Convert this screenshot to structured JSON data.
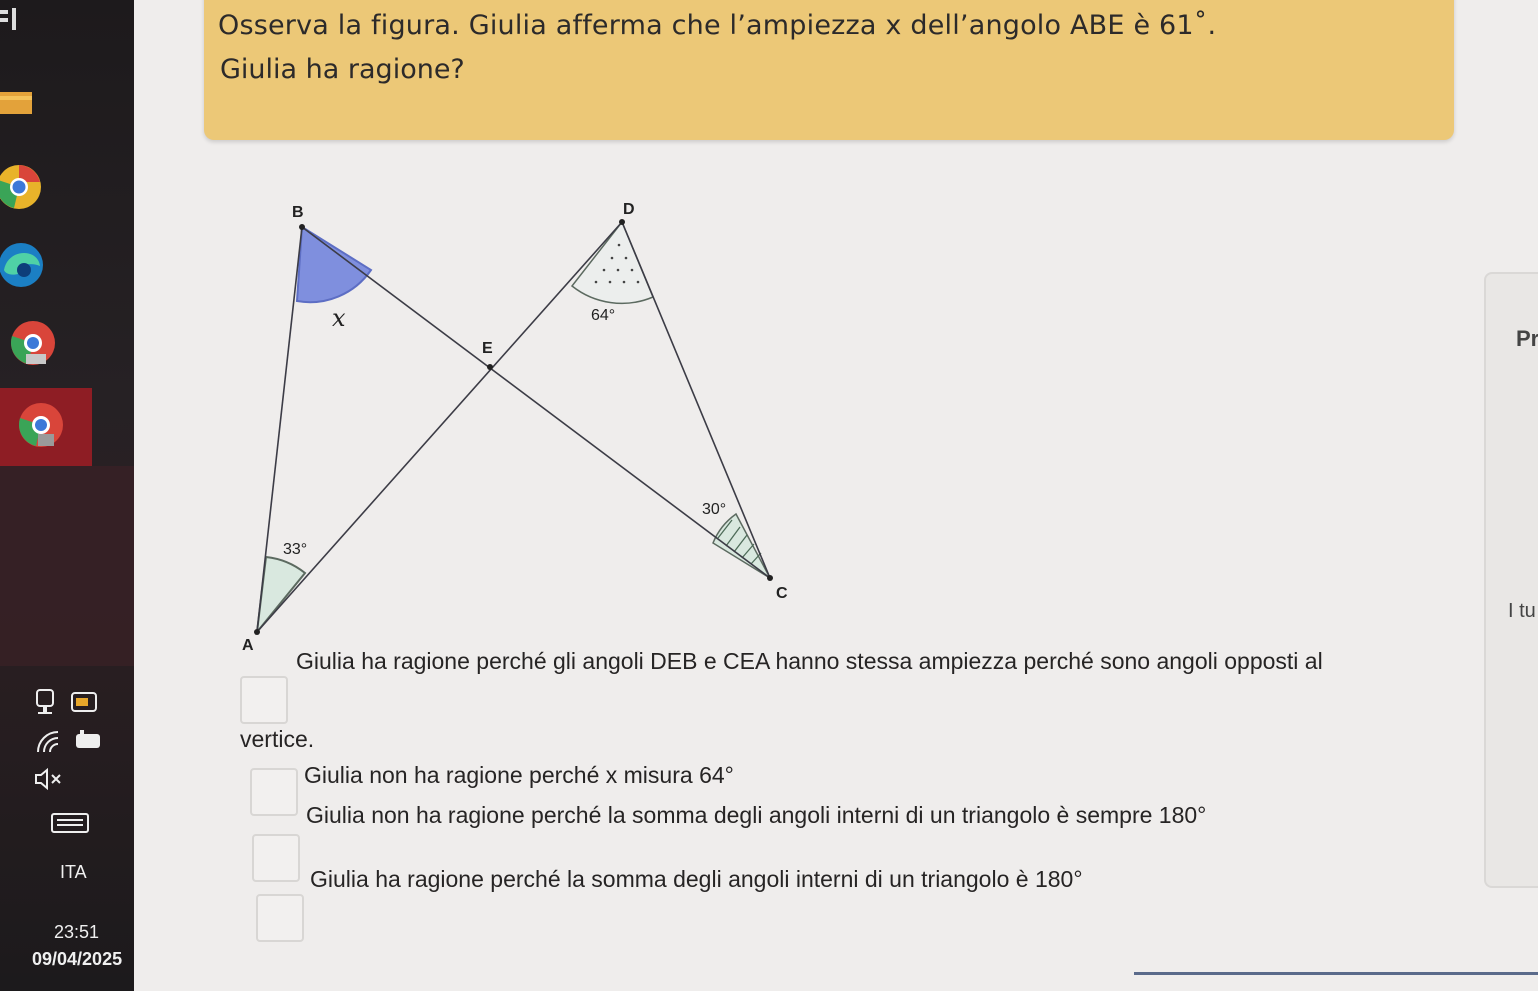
{
  "taskbar": {
    "language": "ITA",
    "time": "23:51",
    "date": "09/04/2025",
    "icons": [
      "app-icon",
      "folder-icon",
      "chrome-icon",
      "edge-icon",
      "chrome-profile-icon",
      "chrome-profile-2-icon",
      "network-icon",
      "battery-icon",
      "wifi-icon",
      "power-icon",
      "mute-icon",
      "keyboard-icon"
    ]
  },
  "question": {
    "line1": "Osserva la figura. Giulia afferma che l’ampiezza x dell’angolo ABE è 61˚.",
    "line2": "Giulia ha ragione?"
  },
  "figure": {
    "points": {
      "A": "A",
      "B": "B",
      "C": "C",
      "D": "D",
      "E": "E"
    },
    "angle_x": "x",
    "angle_d": "64°",
    "angle_c": "30°",
    "angle_a": "33°",
    "colors": {
      "angle_b_fill": "#7f8fde",
      "angle_a_fill": "#d9e8df",
      "lines": "#3c3c46"
    }
  },
  "options": [
    {
      "line1": "Giulia ha ragione perché gli angoli DEB e CEA hanno stessa ampiezza perché sono angoli opposti al",
      "line2": "vertice."
    },
    {
      "text": "Giulia non ha ragione perché x misura",
      "value": "64°"
    },
    {
      "text": "Giulia non ha ragione perché la somma degli angoli interni di un triangolo è sempre",
      "value": "180°"
    },
    {
      "text": "Giulia ha ragione perché la somma degli angoli interni di un triangolo è",
      "value": "180°"
    }
  ],
  "side_panel": {
    "label_top": "Pr",
    "label_bottom": "I tu"
  }
}
